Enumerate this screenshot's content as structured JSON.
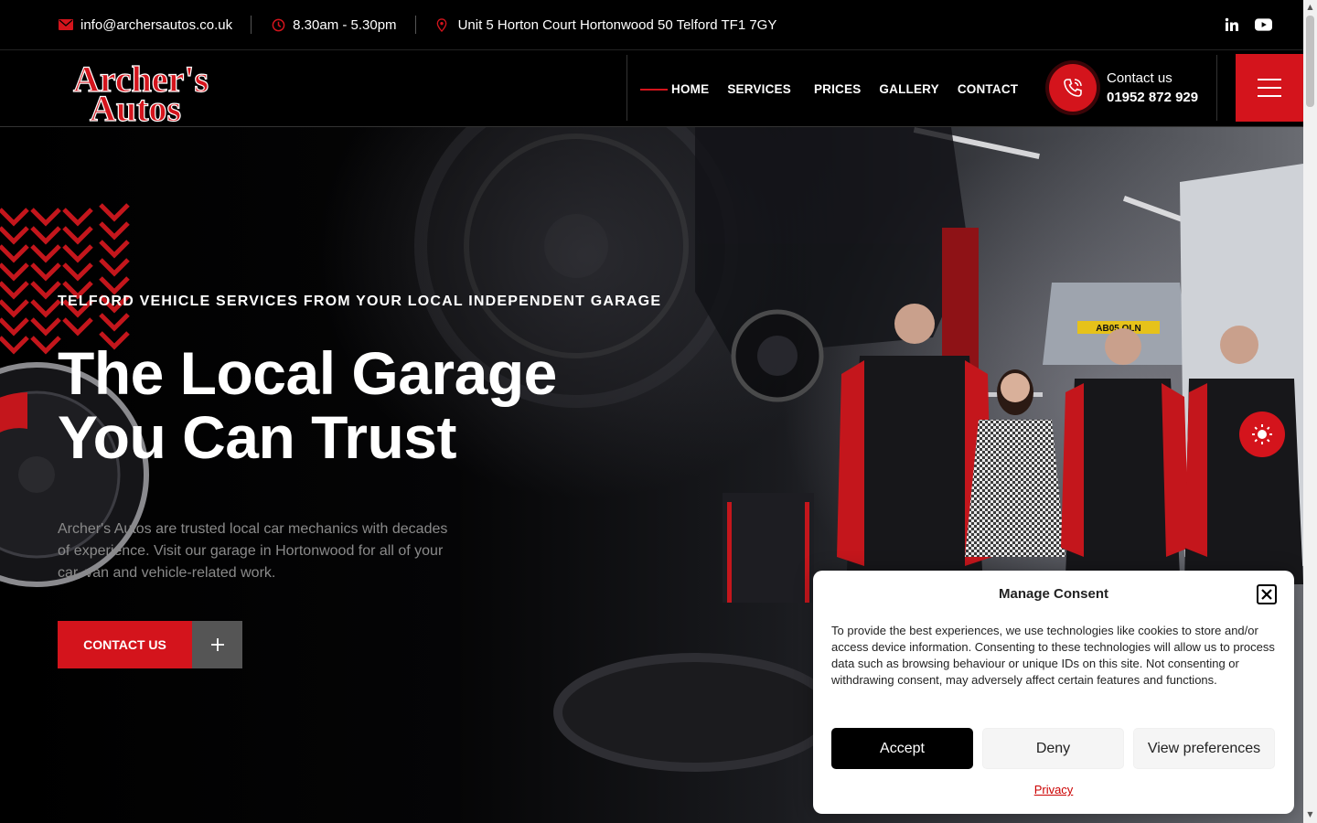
{
  "topbar": {
    "email": "info@archersautos.co.uk",
    "hours": "8.30am - 5.30pm",
    "address": "Unit 5 Horton Court Hortonwood 50 Telford TF1 7GY",
    "social": [
      "linkedin-icon",
      "youtube-icon"
    ]
  },
  "header": {
    "logo": {
      "line1": "Archer's",
      "line2": "Autos"
    },
    "nav": [
      "HOME",
      "SERVICES",
      "PRICES",
      "GALLERY",
      "CONTACT"
    ],
    "contact_label": "Contact us",
    "contact_number": "01952 872 929"
  },
  "hero": {
    "eyebrow": "TELFORD VEHICLE SERVICES FROM YOUR LOCAL INDEPENDENT GARAGE",
    "headline_line1": "The Local Garage",
    "headline_line2": "You Can Trust",
    "text": "Archer's Autos are trusted local car mechanics with decades of experience. Visit our garage in Hortonwood for all of your car, van and vehicle-related work.",
    "cta_label": "CONTACT US",
    "plate": "AB05 OLN"
  },
  "consent": {
    "title": "Manage Consent",
    "body": "To provide the best experiences, we use technologies like cookies to store and/or access device information. Consenting to these technologies will allow us to process data such as browsing behaviour or unique IDs on this site. Not consenting or withdrawing consent, may adversely affect certain features and functions.",
    "accept": "Accept",
    "deny": "Deny",
    "preferences": "View preferences",
    "privacy": "Privacy"
  },
  "colors": {
    "accent": "#d4141c",
    "background": "#000000"
  }
}
